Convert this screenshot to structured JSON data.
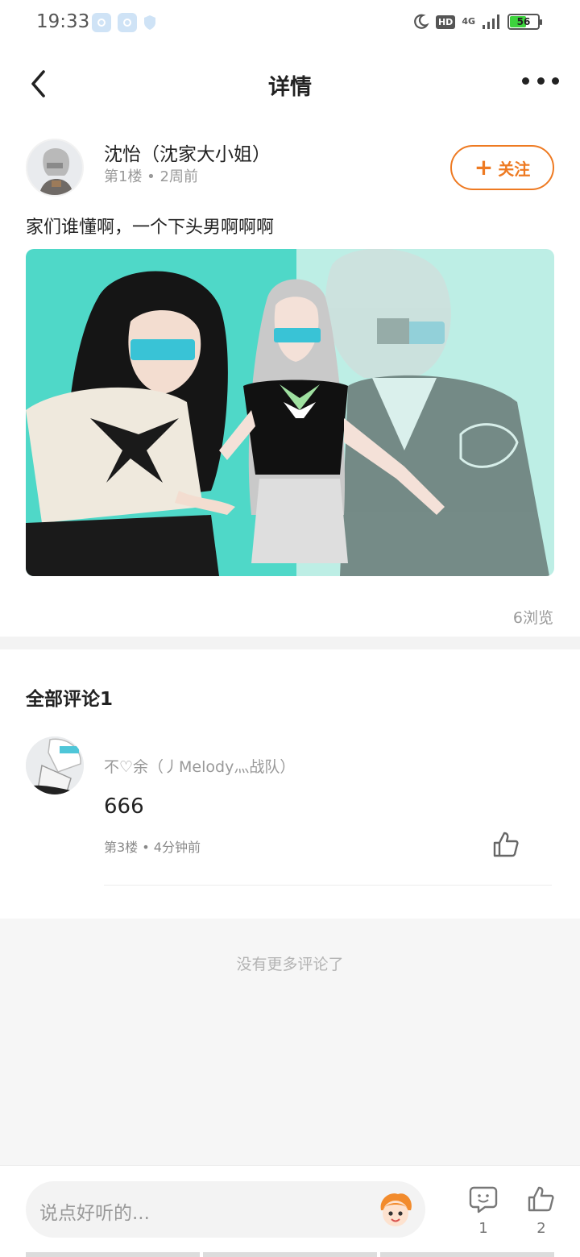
{
  "status_bar": {
    "time": "19:33",
    "hd": "HD",
    "network": "4G",
    "battery": "56"
  },
  "header": {
    "title": "详情"
  },
  "post": {
    "author": "沈怡（沈家大小姐）",
    "meta": "第1楼 • 2周前",
    "follow_label": "关注",
    "text": "家们谁懂啊，一个下头男啊啊啊",
    "views": "6浏览"
  },
  "comments": {
    "title": "全部评论1",
    "items": [
      {
        "user": "不♡余（丿Melody灬战队）",
        "body": "666",
        "meta": "第3楼 • 4分钟前"
      }
    ],
    "no_more": "没有更多评论了"
  },
  "bottom_bar": {
    "placeholder": "说点好听的...",
    "comment_count": "1",
    "like_count": "2"
  },
  "colors": {
    "accent": "#ee7a22",
    "teal_bg": "#4fd8c8",
    "light_teal_bg": "#bdeee5"
  }
}
